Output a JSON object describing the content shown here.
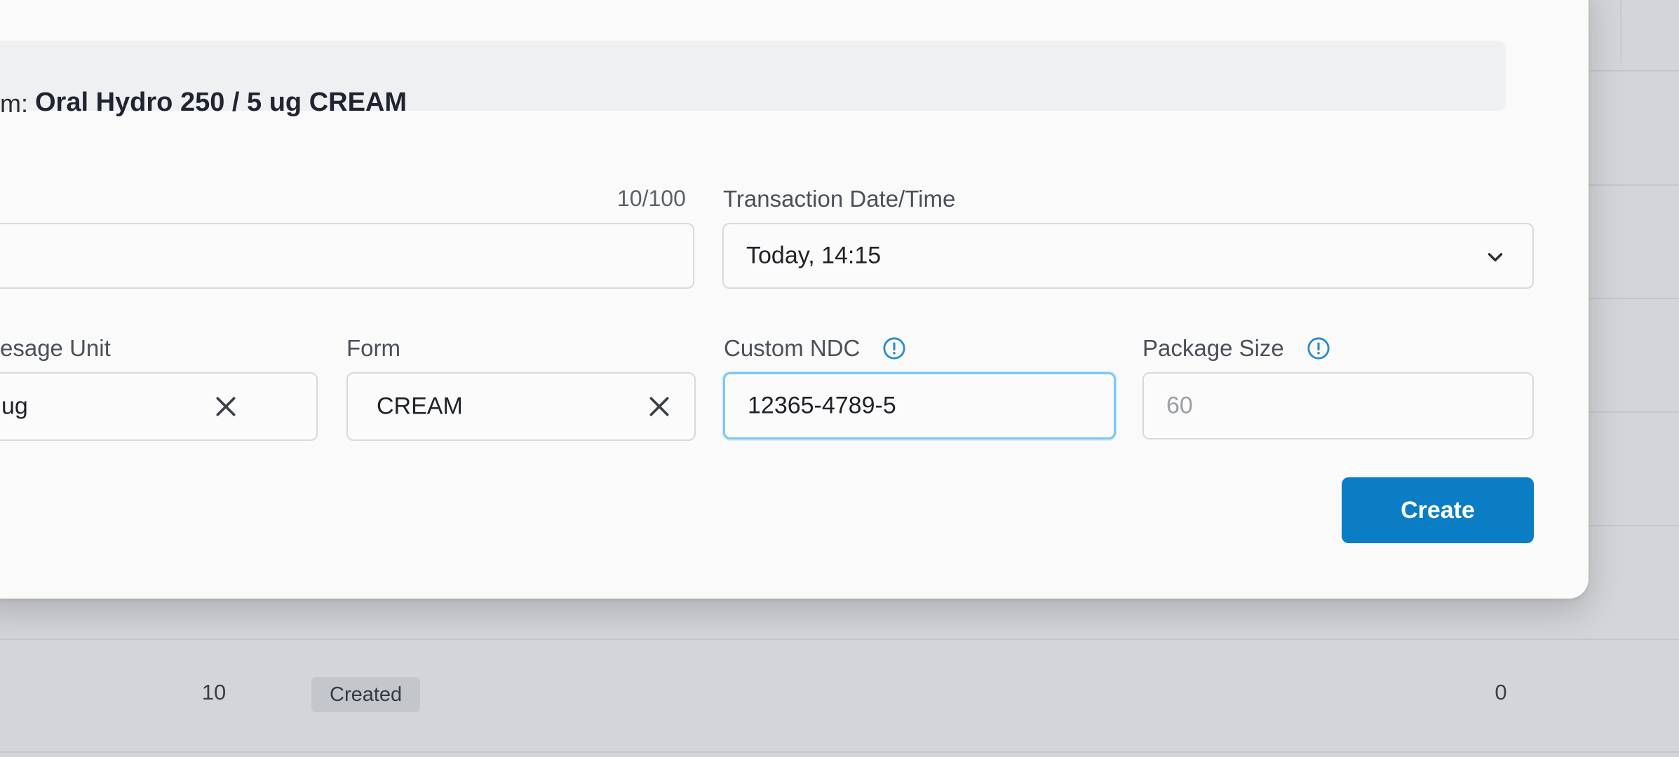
{
  "modal": {
    "item_prefix": "m:",
    "item_name": "Oral Hydro 250 / 5 ug CREAM",
    "quantity": {
      "counter": "10/100",
      "value": ""
    },
    "transaction": {
      "label": "Transaction Date/Time",
      "value": "Today, 14:15"
    },
    "dosage_unit": {
      "label": "esage Unit",
      "value": "ug"
    },
    "form": {
      "label": "Form",
      "value": "CREAM"
    },
    "custom_ndc": {
      "label": "Custom NDC",
      "value": "12365-4789-5"
    },
    "package_size": {
      "label": "Package Size",
      "placeholder": "60"
    },
    "create_label": "Create"
  },
  "background_row": {
    "quantity": "10",
    "status": "Created",
    "count": "0"
  },
  "colors": {
    "accent": "#0a7dc4",
    "focus_border": "#7cc7f0",
    "info_icon": "#2a8ad1"
  }
}
